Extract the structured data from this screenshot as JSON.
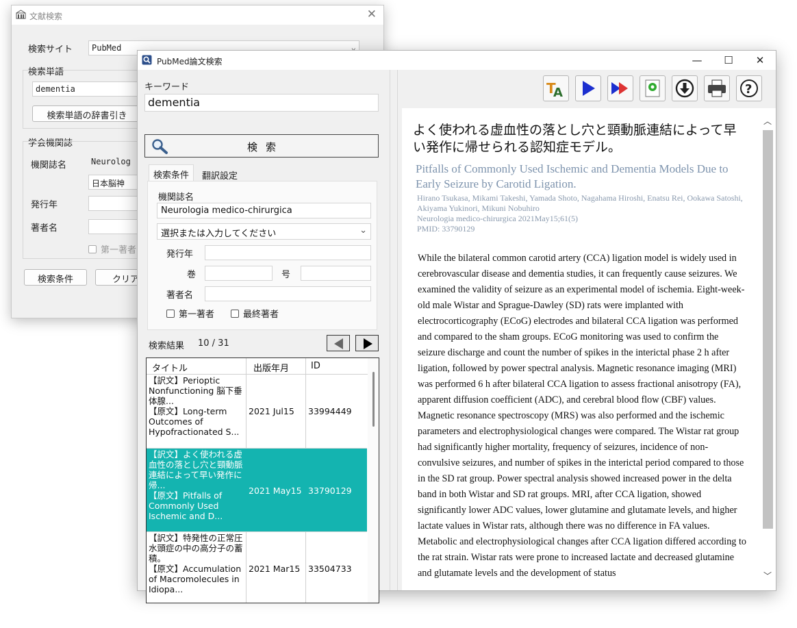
{
  "back_window": {
    "title": "文献検索",
    "search_site_label": "検索サイト",
    "search_site_value": "PubMed",
    "search_terms_label": "検索単語",
    "search_term_value": "dementia",
    "dictionary_button": "検索単語の辞書引き",
    "journal_group_label": "学会機関誌",
    "journal_name_label": "機関誌名",
    "journal_name_value": "Neurolog",
    "journal_select_value": "日本脳神",
    "year_label": "発行年",
    "author_label": "著者名",
    "first_author_label": "第一著者",
    "conditions_button": "検索条件",
    "clear_button": "クリア"
  },
  "front_window": {
    "title": "PubMed論文検索",
    "keyword_label": "キーワード",
    "keyword_value": "dementia",
    "search_button": "検索",
    "tabs": [
      "検索条件",
      "翻訳設定"
    ],
    "journal_name_label": "機関誌名",
    "journal_name_value": "Neurologia medico-chirurgica",
    "journal_select_placeholder": "選択または入力してください",
    "year_label": "発行年",
    "volume_label": "巻",
    "issue_label": "号",
    "author_label": "著者名",
    "first_author_label": "第一著者",
    "last_author_label": "最終著者",
    "results_label": "検索結果",
    "results_count": "10 / 31",
    "table_headers": [
      "タイトル",
      "出版年月",
      "ID"
    ],
    "results": [
      {
        "title": "【訳文】Perioptic Nonfunctioning 脳下垂体腺...\n【原文】Long-term Outcomes of Hypofractionated S...",
        "date": "2021 Jul15",
        "id": "33994449",
        "selected": false
      },
      {
        "title": "【訳文】よく使われる虚血性の落とし穴と頸動脈連結によって早い発作に帰...\n【原文】Pitfalls of Commonly Used Ischemic and D...",
        "date": "2021 May15",
        "id": "33790129",
        "selected": true
      },
      {
        "title": "【訳文】特発性の正常圧水頭症の中の高分子の蓄積。\n【原文】Accumulation of Macromolecules in Idiopa...",
        "date": "2021 Mar15",
        "id": "33504733",
        "selected": false
      }
    ],
    "toolbar_icons": [
      "translate-icon",
      "play-icon",
      "fast-forward-icon",
      "settings-icon",
      "download-icon",
      "print-icon",
      "help-icon"
    ],
    "article": {
      "jp_title": "よく使われる虚血性の落とし穴と頸動脈連結によって早い発作に帰せられる認知症モデル。",
      "en_title": "Pitfalls of Commonly Used Ischemic and Dementia Models Due to Early Seizure by Carotid Ligation.",
      "authors": "Hirano Tsukasa, Mikami Takeshi, Yamada Shoto, Nagahama Hiroshi, Enatsu Rei, Ookawa Satoshi, Akiyama Yukinori, Mikuni Nobuhiro",
      "citation": "Neurologia medico-chirurgica 2021May15;61(5)",
      "pmid": "PMID: 33790129",
      "abstract": "While the bilateral common carotid artery (CCA) ligation model is widely used in cerebrovascular disease and dementia studies, it can frequently cause seizures. We examined the validity of seizure as an experimental model of ischemia. Eight-week-old male Wistar and Sprague-Dawley (SD) rats were implanted with electrocorticography (ECoG) electrodes and bilateral CCA ligation was performed and compared to the sham groups. ECoG monitoring was used to confirm the seizure discharge and count the number of spikes in the interictal phase 2 h after ligation, followed by power spectral analysis. Magnetic resonance imaging (MRI) was performed 6 h after bilateral CCA ligation to assess fractional anisotropy (FA), apparent diffusion coefficient (ADC), and cerebral blood flow (CBF) values. Magnetic resonance spectroscopy (MRS) was also performed and the ischemic parameters and electrophysiological changes were compared. The Wistar rat group had significantly higher mortality, frequency of seizures, incidence of non-convulsive seizures, and number of spikes in the interictal period compared to those in the SD rat group. Power spectral analysis showed increased power in the delta band in both Wistar and SD rat groups. MRI, after CCA ligation, showed significantly lower ADC values, lower glutamine and glutamate levels, and higher lactate values in Wistar rats, although there was no difference in FA values. Metabolic and electrophysiological changes after CCA ligation differed according to the rat strain. Wistar rats were prone to increased lactate and decreased glutamine and glutamate levels and the development of status"
    }
  },
  "colors": {
    "selection": "#14b4b0",
    "en_title": "#7d93ad",
    "meta": "#8a9aae"
  }
}
